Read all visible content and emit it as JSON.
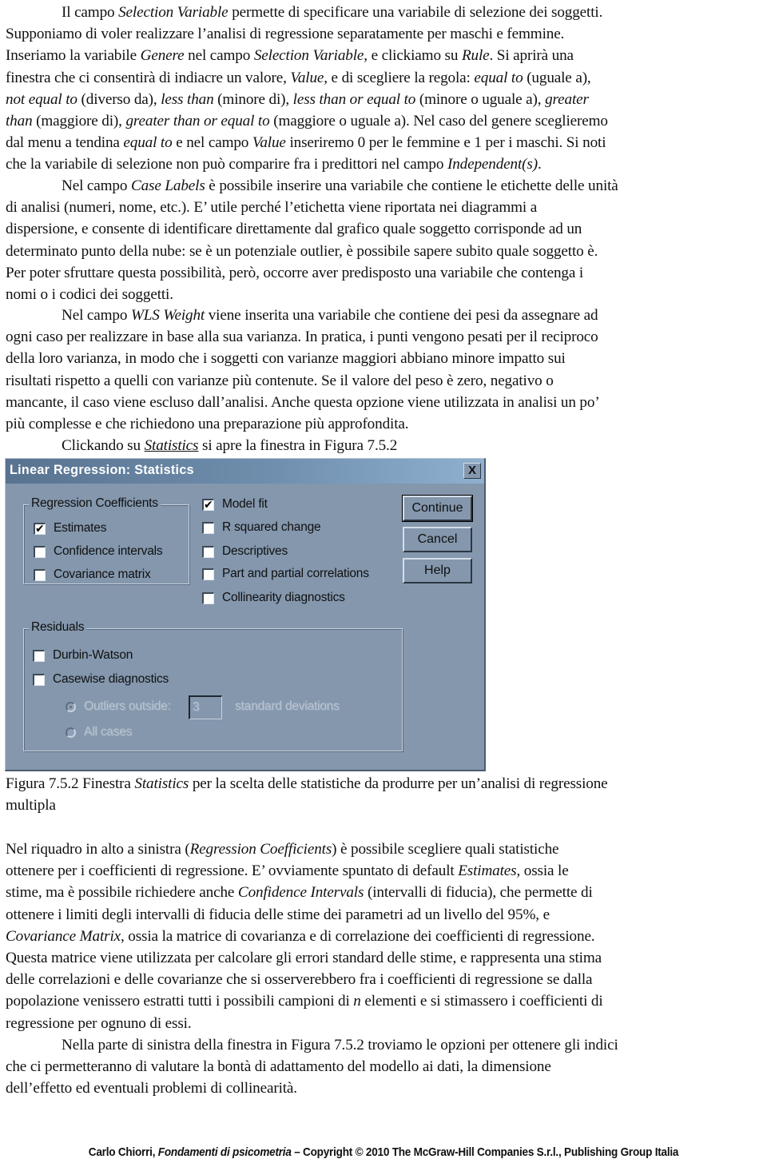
{
  "paragraph_1": {
    "lines": [
      [
        {
          "t": "Il campo "
        },
        {
          "t": "Selection Variable",
          "i": true
        },
        {
          "t": " permette di specificare una variabile di selezione dei soggetti."
        }
      ],
      [
        {
          "t": "Supponiamo di voler realizzare l’analisi di regressione separatamente per maschi e femmine."
        }
      ],
      [
        {
          "t": "Inseriamo la variabile "
        },
        {
          "t": "Genere",
          "i": true
        },
        {
          "t": " nel campo "
        },
        {
          "t": "Selection Variable",
          "i": true
        },
        {
          "t": ", e clickiamo su "
        },
        {
          "t": "Rule",
          "i": true
        },
        {
          "t": ". Si aprirà una"
        }
      ],
      [
        {
          "t": "finestra che ci consentirà di indiacre un valore, "
        },
        {
          "t": "Value",
          "i": true
        },
        {
          "t": ", e di scegliere la regola: "
        },
        {
          "t": "equal to",
          "i": true
        },
        {
          "t": " (uguale a),"
        }
      ],
      [
        {
          "t": "not equal to",
          "i": true
        },
        {
          "t": " (diverso da), "
        },
        {
          "t": "less than",
          "i": true
        },
        {
          "t": " (minore di), "
        },
        {
          "t": "less than or equal to",
          "i": true
        },
        {
          "t": " (minore o uguale a), "
        },
        {
          "t": "greater",
          "i": true
        }
      ],
      [
        {
          "t": "than",
          "i": true
        },
        {
          "t": " (maggiore di), "
        },
        {
          "t": "greater than or equal to",
          "i": true
        },
        {
          "t": " (maggiore o uguale a). Nel caso del genere sceglieremo"
        }
      ],
      [
        {
          "t": "dal menu a tendina "
        },
        {
          "t": "equal to",
          "i": true
        },
        {
          "t": " e nel campo "
        },
        {
          "t": "Value",
          "i": true
        },
        {
          "t": " inseriremo 0 per le femmine e 1 per i maschi. Si noti"
        }
      ],
      [
        {
          "t": "che la variabile di selezione non può comparire fra i predittori nel campo "
        },
        {
          "t": "Independent(s)",
          "i": true
        },
        {
          "t": "."
        }
      ]
    ]
  },
  "paragraph_2": {
    "lines": [
      [
        {
          "t": "Nel campo "
        },
        {
          "t": "Case Labels",
          "i": true
        },
        {
          "t": " è possibile inserire una variabile che contiene le etichette delle unità"
        }
      ],
      [
        {
          "t": "di analisi (numeri, nome, etc.). E’ utile perché l’etichetta viene riportata nei diagrammi a"
        }
      ],
      [
        {
          "t": "dispersione, e consente di identificare direttamente dal grafico quale soggetto corrisponde ad un"
        }
      ],
      [
        {
          "t": "determinato punto della nube: se è un potenziale outlier, è possibile sapere subito quale soggetto è."
        }
      ],
      [
        {
          "t": "Per poter sfruttare questa possibilità, però, occorre aver predisposto una variabile che contenga i"
        }
      ],
      [
        {
          "t": "nomi o i codici dei soggetti."
        }
      ]
    ]
  },
  "paragraph_3": {
    "lines": [
      [
        {
          "t": "Nel campo "
        },
        {
          "t": "WLS Weight",
          "i": true
        },
        {
          "t": " viene inserita una variabile che contiene dei pesi da assegnare ad"
        }
      ],
      [
        {
          "t": "ogni caso per realizzare in base alla sua varianza. In pratica, i punti vengono pesati per il reciproco"
        }
      ],
      [
        {
          "t": "della loro varianza, in modo che i soggetti con varianze maggiori abbiano minore impatto sui"
        }
      ],
      [
        {
          "t": "risultati rispetto a quelli con varianze più contenute. Se il valore del peso è zero, negativo o"
        }
      ],
      [
        {
          "t": "mancante, il caso viene escluso dall’analisi. Anche questa opzione viene utilizzata in analisi un po’"
        }
      ],
      [
        {
          "t": "più complesse e che richiedono una preparazione più approfondita."
        }
      ]
    ]
  },
  "paragraph_4": {
    "lines": [
      [
        {
          "t": "Clickando su "
        },
        {
          "t": "Statistics",
          "i": true,
          "u": true
        },
        {
          "t": " si apre la finestra in Figura 7.5.2"
        }
      ]
    ]
  },
  "dialog": {
    "title": "Linear Regression: Statistics",
    "close_label": "X",
    "regression_coefficients": {
      "legend": "Regression Coefficients",
      "options": [
        {
          "label": "Estimates",
          "checked": true
        },
        {
          "label": "Confidence intervals",
          "checked": false
        },
        {
          "label": "Covariance matrix",
          "checked": false
        }
      ]
    },
    "model_options": [
      {
        "label": "Model fit",
        "checked": true
      },
      {
        "label": "R squared change",
        "checked": false
      },
      {
        "label": "Descriptives",
        "checked": false
      },
      {
        "label": "Part and partial correlations",
        "checked": false
      },
      {
        "label": "Collinearity diagnostics",
        "checked": false
      }
    ],
    "buttons": {
      "continue": "Continue",
      "cancel": "Cancel",
      "help": "Help"
    },
    "residuals": {
      "legend": "Residuals",
      "options": [
        {
          "label": "Durbin-Watson",
          "checked": false
        },
        {
          "label": "Casewise diagnostics",
          "checked": false
        }
      ],
      "outliers_label": "Outliers outside:",
      "outliers_value": "3",
      "outliers_unit": "standard deviations",
      "all_cases_label": "All cases",
      "selected_radio": "outliers"
    }
  },
  "caption": {
    "lines": [
      [
        {
          "t": "Figura 7.5.2 Finestra "
        },
        {
          "t": "Statistics",
          "i": true
        },
        {
          "t": " per la scelta delle statistiche da produrre per un’analisi di regressione"
        }
      ],
      [
        {
          "t": "multipla"
        }
      ]
    ]
  },
  "paragraph_5": {
    "lines": [
      [
        {
          "t": "Nel riquadro in alto a sinistra ("
        },
        {
          "t": "Regression Coefficients",
          "i": true
        },
        {
          "t": ") è possibile scegliere quali statistiche"
        }
      ],
      [
        {
          "t": "ottenere per i coefficienti di regressione. E’ ovviamente spuntato di default "
        },
        {
          "t": "Estimates",
          "i": true
        },
        {
          "t": ", ossia le"
        }
      ],
      [
        {
          "t": "stime, ma è possibile richiedere anche "
        },
        {
          "t": "Confidence Intervals",
          "i": true
        },
        {
          "t": " (intervalli di fiducia), che permette di"
        }
      ],
      [
        {
          "t": "ottenere i limiti degli intervalli di fiducia delle stime dei parametri ad un livello del 95%, e"
        }
      ],
      [
        {
          "t": "Covariance Matrix",
          "i": true
        },
        {
          "t": ", ossia la matrice di covarianza e di correlazione dei coefficienti di regressione."
        }
      ],
      [
        {
          "t": "Questa matrice viene utilizzata per calcolare gli errori standard delle stime, e rappresenta una stima"
        }
      ],
      [
        {
          "t": "delle correlazioni e delle covarianze che si osserverebbero fra i coefficienti di regressione se dalla"
        }
      ],
      [
        {
          "t": "popolazione venissero estratti tutti i possibili campioni di "
        },
        {
          "t": "n",
          "i": true
        },
        {
          "t": " elementi e si stimassero i coefficienti di"
        }
      ],
      [
        {
          "t": "regressione per ognuno di essi."
        }
      ]
    ]
  },
  "paragraph_6": {
    "lines": [
      [
        {
          "t": "Nella parte di sinistra della finestra in Figura 7.5.2 troviamo le opzioni per ottenere gli indici"
        }
      ],
      [
        {
          "t": "che ci permetteranno di valutare la bontà di adattamento del modello ai dati, la dimensione"
        }
      ],
      [
        {
          "t": "dell’effetto ed eventuali problemi di collinearità."
        }
      ]
    ]
  },
  "footer": {
    "author": "Carlo Chiorri, ",
    "book_title": "Fondamenti di psicometria",
    "rest": " – Copyright © 2010 The McGraw-Hill Companies S.r.l., Publishing Group Italia"
  }
}
